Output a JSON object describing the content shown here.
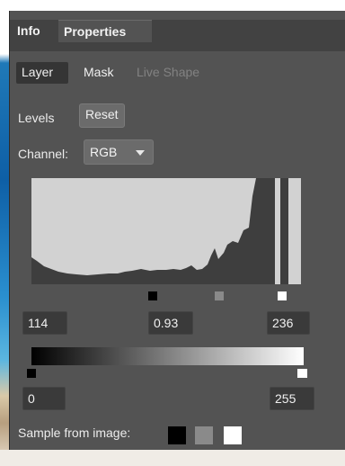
{
  "tabs": {
    "info": "Info",
    "properties": "Properties"
  },
  "subtabs": {
    "layer": "Layer",
    "mask": "Mask",
    "live_shape": "Live Shape"
  },
  "levels": {
    "label": "Levels",
    "reset": "Reset"
  },
  "channel": {
    "label": "Channel:",
    "value": "RGB"
  },
  "input_levels": {
    "black": "114",
    "gamma": "0.93",
    "white": "236"
  },
  "output_levels": {
    "black": "0",
    "white": "255"
  },
  "sample": {
    "label": "Sample from image:"
  },
  "colors": {
    "panel": "#535353",
    "black": "#000000",
    "gray": "#8a8a8a",
    "white": "#ffffff"
  }
}
